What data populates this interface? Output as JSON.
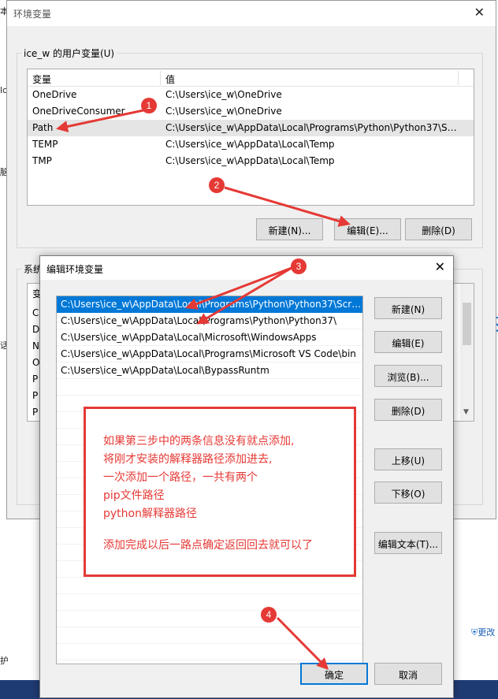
{
  "background": {
    "left_glyphs": [
      "本",
      "lc",
      "脑",
      "话",
      "护"
    ],
    "right_glyphs": [
      "S",
      "lz",
      "Q",
      "更改"
    ]
  },
  "main_window": {
    "title": "环境变量",
    "user_group_label": "ice_w 的用户变量(U)",
    "columns": [
      "变量",
      "值"
    ],
    "user_vars": [
      {
        "name": "OneDrive",
        "value": "C:\\Users\\ice_w\\OneDrive"
      },
      {
        "name": "OneDriveConsumer",
        "value": "C:\\Users\\ice_w\\OneDrive"
      },
      {
        "name": "Path",
        "value": "C:\\Users\\ice_w\\AppData\\Local\\Programs\\Python\\Python37\\Sc..."
      },
      {
        "name": "TEMP",
        "value": "C:\\Users\\ice_w\\AppData\\Local\\Temp"
      },
      {
        "name": "TMP",
        "value": "C:\\Users\\ice_w\\AppData\\Local\\Temp"
      }
    ],
    "buttons": {
      "new": "新建(N)...",
      "edit": "编辑(E)...",
      "delete": "删除(D)"
    },
    "system_group_label": "系统",
    "system_row_letters": [
      "C",
      "D",
      "N",
      "O",
      "P",
      "P",
      "P"
    ],
    "system_header_letter": "变"
  },
  "edit_dialog": {
    "title": "编辑环境变量",
    "paths": [
      "C:\\Users\\ice_w\\AppData\\Local\\Programs\\Python\\Python37\\Scri...",
      "C:\\Users\\ice_w\\AppData\\Local\\Programs\\Python\\Python37\\",
      "C:\\Users\\ice_w\\AppData\\Local\\Microsoft\\WindowsApps",
      "C:\\Users\\ice_w\\AppData\\Local\\Programs\\Microsoft VS Code\\bin",
      "C:\\Users\\ice_w\\AppData\\Local\\BypassRuntm"
    ],
    "buttons": {
      "new": "新建(N)",
      "edit": "编辑(E)",
      "browse": "浏览(B)...",
      "delete": "删除(D)",
      "move_up": "上移(U)",
      "move_down": "下移(O)",
      "edit_text": "编辑文本(T)...",
      "ok": "确定",
      "cancel": "取消"
    }
  },
  "annotation": {
    "lines": [
      "如果第三步中的两条信息没有就点添加,",
      "将刚才安装的解释器路径添加进去,",
      "一次添加一个路径，一共有两个",
      "pip文件路径",
      "python解释器路径",
      "",
      "添加完成以后一路点确定返回回去就可以了"
    ],
    "badges": [
      "1",
      "2",
      "3",
      "4"
    ],
    "color": "#e53935"
  }
}
